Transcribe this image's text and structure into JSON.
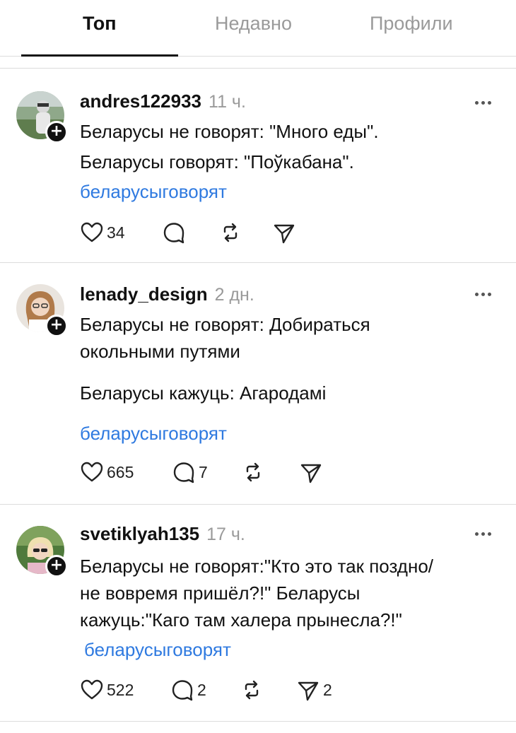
{
  "tabs": [
    {
      "label": "Топ",
      "active": true
    },
    {
      "label": "Недавно",
      "active": false
    },
    {
      "label": "Профили",
      "active": false
    }
  ],
  "posts": [
    {
      "username": "andres122933",
      "time": "11 ч.",
      "lines": [
        "Беларусы не говорят: \"Много еды\".",
        "Беларусы говорят: \"Поўкабана\"."
      ],
      "hashtag": "беларусыговорят",
      "likes": "34",
      "replies": "",
      "reposts": "",
      "shares": ""
    },
    {
      "username": "lenady_design",
      "time": "2 дн.",
      "lines": [
        "Беларусы не говорят: Добираться",
        "окольными путями",
        "Беларусы кажуць: Агародамі"
      ],
      "hashtag": "беларусыговорят",
      "likes": "665",
      "replies": "7",
      "reposts": "",
      "shares": ""
    },
    {
      "username": "svetiklyah135",
      "time": "17 ч.",
      "lines": [
        "Беларусы не говорят:\"Кто это так поздно/",
        "не вовремя пришёл?!\" Беларусы",
        "кажуць:\"Каго там халера прынесла?!\""
      ],
      "hashtag": "беларусыговорят",
      "likes": "522",
      "replies": "2",
      "reposts": "",
      "shares": "2"
    }
  ],
  "icons": {
    "like": "heart-icon",
    "reply": "comment-bubble-icon",
    "repost": "repost-arrows-icon",
    "share": "send-paper-plane-icon",
    "more": "more-horizontal-icon",
    "follow": "plus-follow-icon"
  },
  "colors": {
    "hashtag": "#2f7ae0",
    "muted": "#9a9a9a",
    "text": "#111111",
    "divider": "#dcdcdc"
  }
}
